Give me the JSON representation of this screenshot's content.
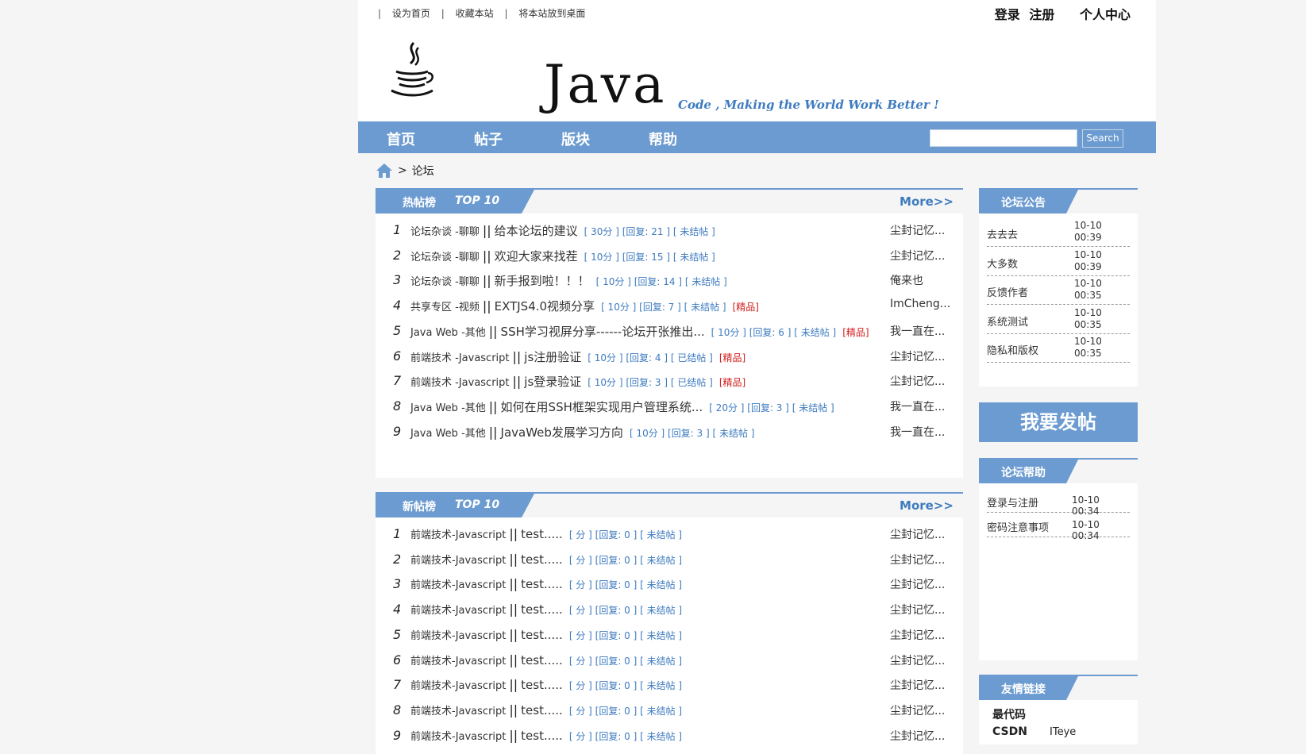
{
  "top": {
    "links": [
      "设为首页",
      "收藏本站",
      "将本站放到桌面"
    ],
    "login": "登录",
    "register": "注册",
    "personal_center": "个人中心"
  },
  "banner": {
    "logo_text": "Java",
    "slogan": "Code , Making the World Work Better !"
  },
  "nav": {
    "items": [
      "首页",
      "帖子",
      "版块",
      "帮助"
    ],
    "search_placeholder": "",
    "search_button": "Search"
  },
  "breadcrumb": {
    "current": "论坛",
    "sep": ">"
  },
  "hot": {
    "title": "热帖榜",
    "top": "TOP 10",
    "more": "More>>",
    "rows": [
      {
        "num": "1",
        "cat": "论坛杂谈 -聊聊",
        "title": "给本论坛的建议",
        "meta": "[ 30分 ] [回复: 21 ] [ 未结帖 ]",
        "jp": "",
        "author": "尘封记忆..."
      },
      {
        "num": "2",
        "cat": "论坛杂谈 -聊聊",
        "title": "欢迎大家来找茬",
        "meta": "[ 10分 ] [回复: 15 ] [ 未结帖 ]",
        "jp": "",
        "author": "尘封记忆..."
      },
      {
        "num": "3",
        "cat": "论坛杂谈 -聊聊",
        "title": "新手报到啦！！！",
        "meta": "[ 10分 ] [回复: 14 ] [ 未结帖 ]",
        "jp": "",
        "author": "俺来也"
      },
      {
        "num": "4",
        "cat": "共享专区 -视频",
        "title": "EXTJS4.0视频分享",
        "meta": "[ 10分 ] [回复: 7 ] [ 未结帖 ]",
        "jp": "[精品]",
        "author": "ImCheng..."
      },
      {
        "num": "5",
        "cat": "Java Web -其他",
        "title": "SSH学习视屏分享------论坛开张推出...",
        "meta": "[ 10分 ] [回复: 6 ] [ 未结帖 ]",
        "jp": "[精品]",
        "author": "我一直在..."
      },
      {
        "num": "6",
        "cat": "前端技术 -Javascript",
        "title": "js注册验证",
        "meta": "[ 10分 ] [回复: 4 ] [ 已结帖 ]",
        "jp": "[精品]",
        "author": "尘封记忆..."
      },
      {
        "num": "7",
        "cat": "前端技术 -Javascript",
        "title": "js登录验证",
        "meta": "[ 10分 ] [回复: 3 ] [ 已结帖 ]",
        "jp": "[精品]",
        "author": "尘封记忆..."
      },
      {
        "num": "8",
        "cat": "Java Web -其他",
        "title": "如何在用SSH框架实现用户管理系统...",
        "meta": "[ 20分 ] [回复: 3 ] [ 未结帖 ]",
        "jp": "",
        "author": "我一直在..."
      },
      {
        "num": "9",
        "cat": "Java Web -其他",
        "title": "JavaWeb发展学习方向",
        "meta": "[ 10分 ] [回复: 3 ] [ 未结帖 ]",
        "jp": "",
        "author": "我一直在..."
      }
    ]
  },
  "new": {
    "title": "新帖榜",
    "top": "TOP 10",
    "more": "More>>",
    "rows": [
      {
        "num": "1",
        "cat": "前端技术-Javascript",
        "title": "test.....",
        "meta": "[ 分 ] [回复: 0 ] [ 未结帖 ]",
        "author": "尘封记忆..."
      },
      {
        "num": "2",
        "cat": "前端技术-Javascript",
        "title": "test.....",
        "meta": "[ 分 ] [回复: 0 ] [ 未结帖 ]",
        "author": "尘封记忆..."
      },
      {
        "num": "3",
        "cat": "前端技术-Javascript",
        "title": "test.....",
        "meta": "[ 分 ] [回复: 0 ] [ 未结帖 ]",
        "author": "尘封记忆..."
      },
      {
        "num": "4",
        "cat": "前端技术-Javascript",
        "title": "test.....",
        "meta": "[ 分 ] [回复: 0 ] [ 未结帖 ]",
        "author": "尘封记忆..."
      },
      {
        "num": "5",
        "cat": "前端技术-Javascript",
        "title": "test.....",
        "meta": "[ 分 ] [回复: 0 ] [ 未结帖 ]",
        "author": "尘封记忆..."
      },
      {
        "num": "6",
        "cat": "前端技术-Javascript",
        "title": "test.....",
        "meta": "[ 分 ] [回复: 0 ] [ 未结帖 ]",
        "author": "尘封记忆..."
      },
      {
        "num": "7",
        "cat": "前端技术-Javascript",
        "title": "test.....",
        "meta": "[ 分 ] [回复: 0 ] [ 未结帖 ]",
        "author": "尘封记忆..."
      },
      {
        "num": "8",
        "cat": "前端技术-Javascript",
        "title": "test.....",
        "meta": "[ 分 ] [回复: 0 ] [ 未结帖 ]",
        "author": "尘封记忆..."
      },
      {
        "num": "9",
        "cat": "前端技术-Javascript",
        "title": "test.....",
        "meta": "[ 分 ] [回复: 0 ] [ 未结帖 ]",
        "author": "尘封记忆..."
      }
    ]
  },
  "notice": {
    "title": "论坛公告",
    "items": [
      {
        "title": "去去去",
        "date": "10-10",
        "time": "00:39"
      },
      {
        "title": "大多数",
        "date": "10-10",
        "time": "00:39"
      },
      {
        "title": "反馈作者",
        "date": "10-10",
        "time": "00:35"
      },
      {
        "title": "系统测试",
        "date": "10-10",
        "time": "00:35"
      },
      {
        "title": "隐私和版权",
        "date": "10-10",
        "time": "00:35"
      }
    ]
  },
  "post_button": "我要发帖",
  "help": {
    "title": "论坛帮助",
    "items": [
      {
        "title": "登录与注册",
        "date": "10-10 00:34"
      },
      {
        "title": "密码注意事项",
        "date": "10-10 00:34"
      }
    ]
  },
  "friends": {
    "title": "友情链接",
    "items": [
      "最代码",
      "CSDN",
      "ITeye"
    ]
  },
  "colors": {
    "accent": "#6b9bd0",
    "link": "#3e7bbf",
    "essence": "#d21d1d"
  }
}
